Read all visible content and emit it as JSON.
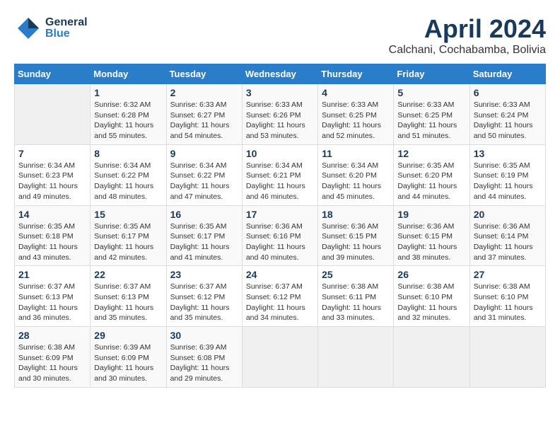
{
  "header": {
    "logo_general": "General",
    "logo_blue": "Blue",
    "month_title": "April 2024",
    "location": "Calchani, Cochabamba, Bolivia"
  },
  "days_of_week": [
    "Sunday",
    "Monday",
    "Tuesday",
    "Wednesday",
    "Thursday",
    "Friday",
    "Saturday"
  ],
  "weeks": [
    [
      {
        "day": "",
        "info": ""
      },
      {
        "day": "1",
        "info": "Sunrise: 6:32 AM\nSunset: 6:28 PM\nDaylight: 11 hours\nand 55 minutes."
      },
      {
        "day": "2",
        "info": "Sunrise: 6:33 AM\nSunset: 6:27 PM\nDaylight: 11 hours\nand 54 minutes."
      },
      {
        "day": "3",
        "info": "Sunrise: 6:33 AM\nSunset: 6:26 PM\nDaylight: 11 hours\nand 53 minutes."
      },
      {
        "day": "4",
        "info": "Sunrise: 6:33 AM\nSunset: 6:25 PM\nDaylight: 11 hours\nand 52 minutes."
      },
      {
        "day": "5",
        "info": "Sunrise: 6:33 AM\nSunset: 6:25 PM\nDaylight: 11 hours\nand 51 minutes."
      },
      {
        "day": "6",
        "info": "Sunrise: 6:33 AM\nSunset: 6:24 PM\nDaylight: 11 hours\nand 50 minutes."
      }
    ],
    [
      {
        "day": "7",
        "info": "Sunrise: 6:34 AM\nSunset: 6:23 PM\nDaylight: 11 hours\nand 49 minutes."
      },
      {
        "day": "8",
        "info": "Sunrise: 6:34 AM\nSunset: 6:22 PM\nDaylight: 11 hours\nand 48 minutes."
      },
      {
        "day": "9",
        "info": "Sunrise: 6:34 AM\nSunset: 6:22 PM\nDaylight: 11 hours\nand 47 minutes."
      },
      {
        "day": "10",
        "info": "Sunrise: 6:34 AM\nSunset: 6:21 PM\nDaylight: 11 hours\nand 46 minutes."
      },
      {
        "day": "11",
        "info": "Sunrise: 6:34 AM\nSunset: 6:20 PM\nDaylight: 11 hours\nand 45 minutes."
      },
      {
        "day": "12",
        "info": "Sunrise: 6:35 AM\nSunset: 6:20 PM\nDaylight: 11 hours\nand 44 minutes."
      },
      {
        "day": "13",
        "info": "Sunrise: 6:35 AM\nSunset: 6:19 PM\nDaylight: 11 hours\nand 44 minutes."
      }
    ],
    [
      {
        "day": "14",
        "info": "Sunrise: 6:35 AM\nSunset: 6:18 PM\nDaylight: 11 hours\nand 43 minutes."
      },
      {
        "day": "15",
        "info": "Sunrise: 6:35 AM\nSunset: 6:17 PM\nDaylight: 11 hours\nand 42 minutes."
      },
      {
        "day": "16",
        "info": "Sunrise: 6:35 AM\nSunset: 6:17 PM\nDaylight: 11 hours\nand 41 minutes."
      },
      {
        "day": "17",
        "info": "Sunrise: 6:36 AM\nSunset: 6:16 PM\nDaylight: 11 hours\nand 40 minutes."
      },
      {
        "day": "18",
        "info": "Sunrise: 6:36 AM\nSunset: 6:15 PM\nDaylight: 11 hours\nand 39 minutes."
      },
      {
        "day": "19",
        "info": "Sunrise: 6:36 AM\nSunset: 6:15 PM\nDaylight: 11 hours\nand 38 minutes."
      },
      {
        "day": "20",
        "info": "Sunrise: 6:36 AM\nSunset: 6:14 PM\nDaylight: 11 hours\nand 37 minutes."
      }
    ],
    [
      {
        "day": "21",
        "info": "Sunrise: 6:37 AM\nSunset: 6:13 PM\nDaylight: 11 hours\nand 36 minutes."
      },
      {
        "day": "22",
        "info": "Sunrise: 6:37 AM\nSunset: 6:13 PM\nDaylight: 11 hours\nand 35 minutes."
      },
      {
        "day": "23",
        "info": "Sunrise: 6:37 AM\nSunset: 6:12 PM\nDaylight: 11 hours\nand 35 minutes."
      },
      {
        "day": "24",
        "info": "Sunrise: 6:37 AM\nSunset: 6:12 PM\nDaylight: 11 hours\nand 34 minutes."
      },
      {
        "day": "25",
        "info": "Sunrise: 6:38 AM\nSunset: 6:11 PM\nDaylight: 11 hours\nand 33 minutes."
      },
      {
        "day": "26",
        "info": "Sunrise: 6:38 AM\nSunset: 6:10 PM\nDaylight: 11 hours\nand 32 minutes."
      },
      {
        "day": "27",
        "info": "Sunrise: 6:38 AM\nSunset: 6:10 PM\nDaylight: 11 hours\nand 31 minutes."
      }
    ],
    [
      {
        "day": "28",
        "info": "Sunrise: 6:38 AM\nSunset: 6:09 PM\nDaylight: 11 hours\nand 30 minutes."
      },
      {
        "day": "29",
        "info": "Sunrise: 6:39 AM\nSunset: 6:09 PM\nDaylight: 11 hours\nand 30 minutes."
      },
      {
        "day": "30",
        "info": "Sunrise: 6:39 AM\nSunset: 6:08 PM\nDaylight: 11 hours\nand 29 minutes."
      },
      {
        "day": "",
        "info": ""
      },
      {
        "day": "",
        "info": ""
      },
      {
        "day": "",
        "info": ""
      },
      {
        "day": "",
        "info": ""
      }
    ]
  ]
}
